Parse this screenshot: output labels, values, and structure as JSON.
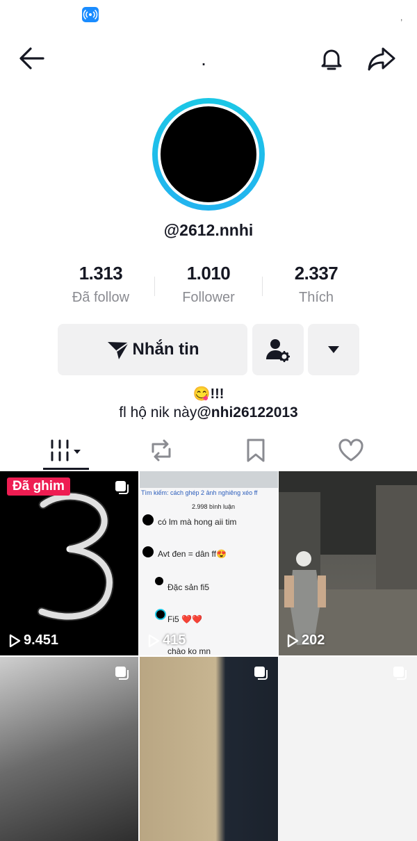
{
  "profile": {
    "title": ".",
    "username": "@2612.nnhi",
    "stats": [
      {
        "value": "1.313",
        "label": "Đã follow"
      },
      {
        "value": "1.010",
        "label": "Follower"
      },
      {
        "value": "2.337",
        "label": "Thích"
      }
    ],
    "bio_line1": "😋!!!",
    "bio_line2_text": "fl hộ nik này",
    "bio_line2_mention": "@nhi26122013"
  },
  "actions": {
    "message_label": "Nhắn tin"
  },
  "tabs": [
    "videos-tab",
    "repost-tab",
    "saved-tab",
    "liked-tab"
  ],
  "videos": [
    {
      "badge": "Đã ghim",
      "views": "9.451"
    },
    {
      "views": "415"
    },
    {
      "views": "202"
    }
  ],
  "video2_comments": {
    "search": "Tìm kiếm: cách ghép 2 ảnh nghiêng xéo ff",
    "count": "2.998 bình luận",
    "lines": [
      "có lm mà hong aii tim",
      "Avt đen = dân ff😍",
      "Đặc sản fi5",
      "Fi5 ❤️❤️",
      "chào ko mn"
    ]
  },
  "colors": {
    "ring": "#20bfe9",
    "pin": "#ee1d52",
    "button_bg": "#f1f1f2"
  }
}
